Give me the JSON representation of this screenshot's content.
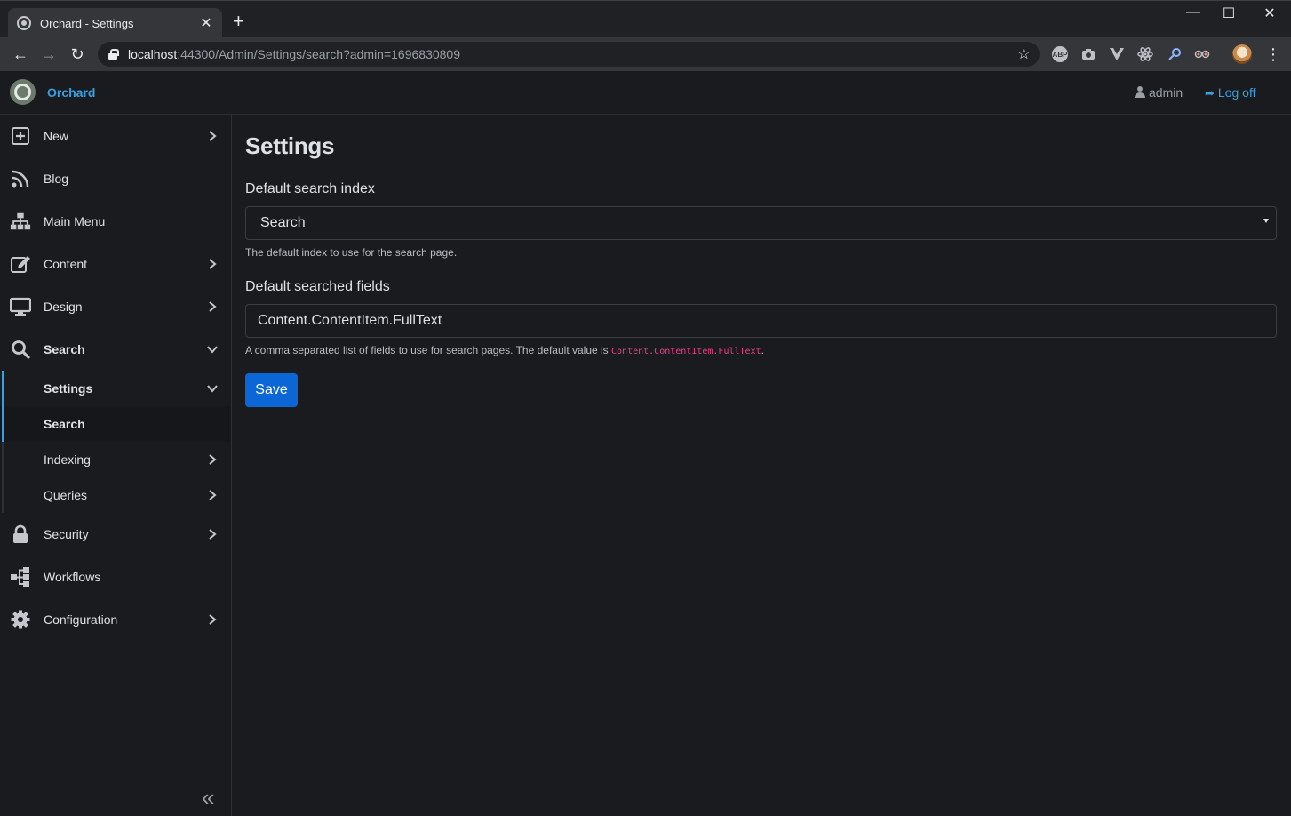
{
  "browser": {
    "tab_title": "Orchard - Settings",
    "tab_close": "✕",
    "new_tab": "+",
    "url_host": "localhost",
    "url_rest": ":44300/Admin/Settings/search?admin=1696830809",
    "window_controls": {
      "minimize": "—",
      "maximize": "☐",
      "close": "✕"
    },
    "nav": {
      "back": "←",
      "forward": "→",
      "reload": "↻"
    },
    "star": "☆",
    "extensions": [
      {
        "icon": "abp-icon",
        "text": "ABP",
        "color": "#bdc1c6"
      },
      {
        "icon": "camera-icon",
        "text": "",
        "color": "#bdc1c6"
      },
      {
        "icon": "vue-icon",
        "text": "",
        "color": "#bdc1c6"
      },
      {
        "icon": "react-icon",
        "text": "",
        "color": "#bdc1c6"
      },
      {
        "icon": "key-icon",
        "text": "",
        "color": "#8ab4f8"
      },
      {
        "icon": "glasses-icon",
        "text": "",
        "color": "#bdc1c6"
      }
    ],
    "menu": "⋮"
  },
  "header": {
    "brand": "Orchard",
    "user": "admin",
    "logoff": "Log off",
    "accent_color": "#3a9fe0"
  },
  "sidebar": {
    "items": [
      {
        "label": "New",
        "icon": "plus-square-icon",
        "chevron": "right"
      },
      {
        "label": "Blog",
        "icon": "rss-icon",
        "chevron": "none"
      },
      {
        "label": "Main Menu",
        "icon": "sitemap-icon",
        "chevron": "none"
      },
      {
        "label": "Content",
        "icon": "edit-icon",
        "chevron": "right"
      },
      {
        "label": "Design",
        "icon": "desktop-icon",
        "chevron": "right"
      },
      {
        "label": "Search",
        "icon": "search-icon",
        "chevron": "down"
      }
    ],
    "search_children": [
      {
        "label": "Settings",
        "chevron": "down"
      },
      {
        "label": "Search",
        "chevron": "none"
      },
      {
        "label": "Indexing",
        "chevron": "right"
      },
      {
        "label": "Queries",
        "chevron": "right"
      }
    ],
    "lower_items": [
      {
        "label": "Security",
        "icon": "lock-icon",
        "chevron": "right"
      },
      {
        "label": "Workflows",
        "icon": "workflow-icon",
        "chevron": "none"
      },
      {
        "label": "Configuration",
        "icon": "cog-icon",
        "chevron": "right"
      }
    ],
    "collapse_label": "«"
  },
  "main": {
    "title": "Settings",
    "index_label": "Default search index",
    "index_value": "Search",
    "index_hint": "The default index to use for the search page.",
    "fields_label": "Default searched fields",
    "fields_value": "Content.ContentItem.FullText",
    "fields_hint_prefix": "A comma separated list of fields to use for search pages. The default value is ",
    "fields_hint_code": "Content.ContentItem.FullText",
    "fields_hint_suffix": ".",
    "save_label": "Save",
    "primary_color": "#0b67d6"
  }
}
